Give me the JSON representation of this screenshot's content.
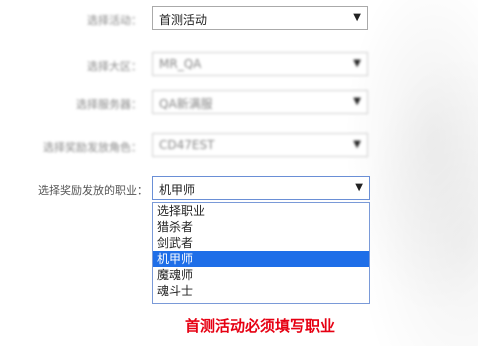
{
  "form": {
    "activity": {
      "label": "选择活动：",
      "value": "首测活动"
    },
    "region": {
      "label": "选择大区：",
      "value": "MR_QA"
    },
    "server": {
      "label": "选择服务器：",
      "value": "QA新满服"
    },
    "role": {
      "label": "选择奖励发放角色：",
      "value": "CD47EST"
    },
    "profession": {
      "label": "选择奖励发放的职业：",
      "value": "机甲师",
      "options": [
        "选择职业",
        "猎杀者",
        "剑武者",
        "机甲师",
        "魔魂师",
        "魂斗士"
      ],
      "selected_index": 3
    }
  },
  "notice": "首测活动必须填写职业",
  "icons": {
    "dropdown_arrow": "▼"
  }
}
